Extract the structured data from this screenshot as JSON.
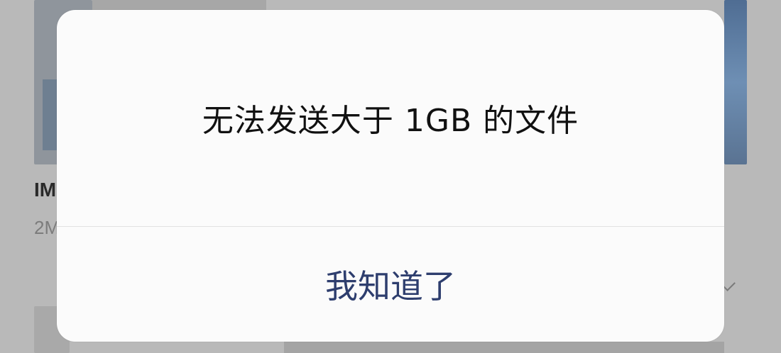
{
  "background": {
    "file_title": "IM",
    "file_size": "2M"
  },
  "dialog": {
    "message": "无法发送大于 1GB 的文件",
    "button_label": "我知道了"
  },
  "colors": {
    "message_text": "#111111",
    "button_text": "#2e3e6e",
    "dialog_bg": "#fbfbfb",
    "backdrop": "#b9b9b9"
  }
}
